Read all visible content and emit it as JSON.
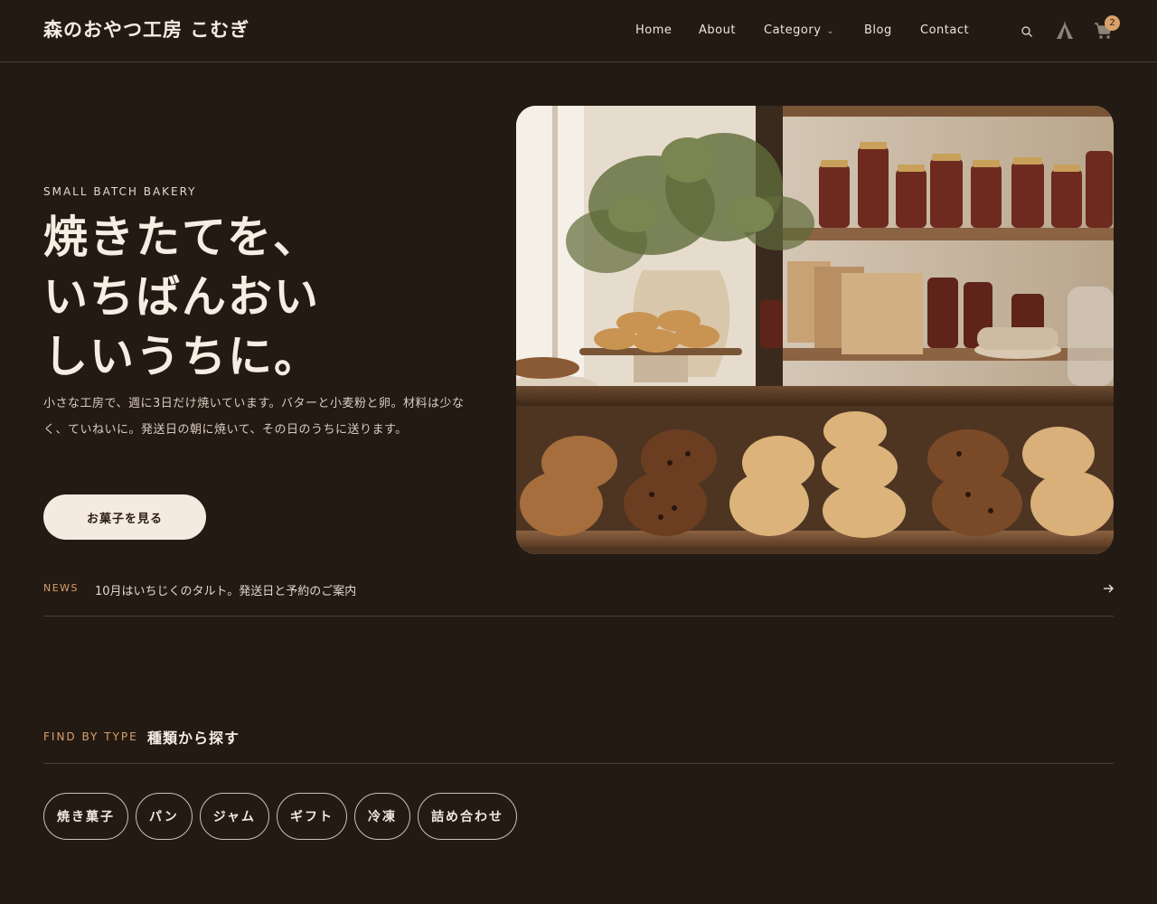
{
  "header": {
    "logo": "森のおやつ工房 こむぎ",
    "nav": [
      {
        "label": "Home"
      },
      {
        "label": "About"
      },
      {
        "label": "Category",
        "has_dropdown": true
      },
      {
        "label": "Blog"
      },
      {
        "label": "Contact"
      }
    ],
    "icons": [
      "search-icon",
      "tent-icon",
      "cart-icon"
    ],
    "cart_count": "2"
  },
  "hero": {
    "eyebrow": "SMALL BATCH BAKERY",
    "headline_lines": [
      "焼きたてを、",
      "いちばんおい",
      "しいうちに。"
    ],
    "lede": "小さな工房で、週に3日だけ焼いています。バターと小麦粉と卵。材料は少なく、ていねいに。発送日の朝に焼いて、その日のうちに送ります。",
    "cta_label": "お菓子を見る",
    "image_alt": "bakery shelves with cookies, jam jars and paper bags"
  },
  "news": {
    "label": "NEWS",
    "text": "10月はいちじくのタルト。発送日と予約のご案内",
    "arrow_icon": "arrow-right-icon"
  },
  "find": {
    "label": "FIND BY TYPE",
    "title": "種類から探す",
    "chips": [
      "焼き菓子",
      "パン",
      "ジャム",
      "ギフト",
      "冷凍",
      "詰め合わせ"
    ]
  },
  "colors": {
    "background": "#241a14",
    "accent": "#d9a06a",
    "cta_bg": "#f4eadf",
    "text": "#f3e8dc"
  }
}
